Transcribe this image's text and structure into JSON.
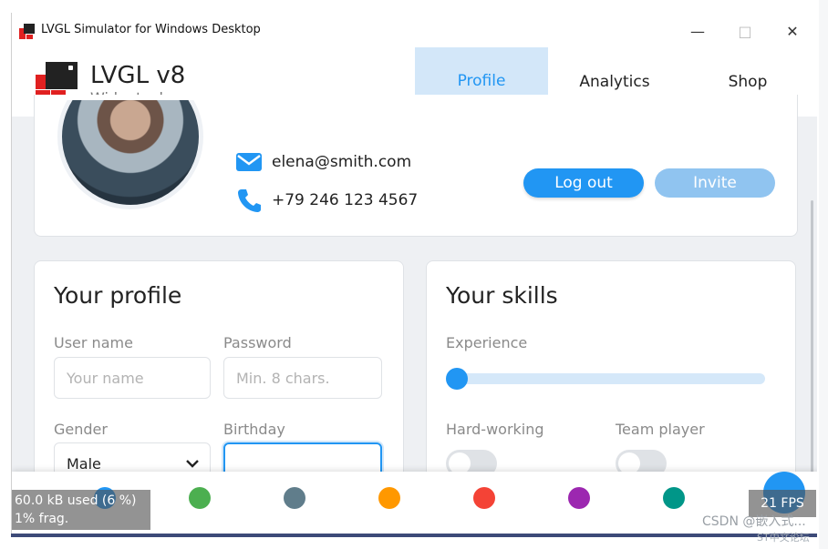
{
  "window": {
    "title": "LVGL Simulator for Windows Desktop",
    "minimize_glyph": "—",
    "maximize_glyph": "□",
    "close_glyph": "✕"
  },
  "header": {
    "brand_title": "LVGL v8",
    "brand_subtitle": "Widgets demo",
    "tabs": [
      {
        "label": "Profile",
        "active": true
      },
      {
        "label": "Analytics",
        "active": false
      },
      {
        "label": "Shop",
        "active": false
      }
    ]
  },
  "profile": {
    "email": "elena@smith.com",
    "phone": "+79 246 123 4567",
    "logout_label": "Log out",
    "invite_label": "Invite"
  },
  "your_profile": {
    "title": "Your profile",
    "username_label": "User name",
    "username_placeholder": "Your name",
    "password_label": "Password",
    "password_placeholder": "Min. 8 chars.",
    "gender_label": "Gender",
    "gender_value": "Male",
    "birthday_label": "Birthday"
  },
  "your_skills": {
    "title": "Your skills",
    "experience_label": "Experience",
    "experience_value": 0,
    "hardworking_label": "Hard-working",
    "hardworking_on": false,
    "teamplayer_label": "Team player",
    "teamplayer_on": false
  },
  "overlays": {
    "memory_line1": "60.0 kB used (6 %)",
    "memory_line2": "1% frag.",
    "fps": "21 FPS"
  },
  "watermark": {
    "line1": "CSDN @嵌入式...",
    "line2": "ST中文论坛"
  },
  "colors": {
    "primary": "#2196f3",
    "primary_light": "#d3e7f9",
    "invite_button": "#90c4f0",
    "palette": [
      "#2196f3",
      "#4caf50",
      "#607d8b",
      "#ff9800",
      "#f44336",
      "#9c27b0",
      "#009688"
    ],
    "logo_red": "#e02020",
    "logo_dark": "#222222"
  }
}
